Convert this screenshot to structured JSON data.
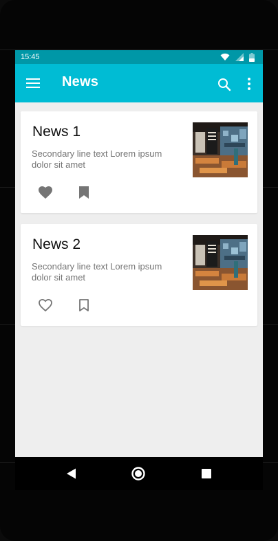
{
  "status_bar": {
    "time": "15:45",
    "icons": [
      "wifi-icon",
      "signal-icon",
      "battery-icon"
    ]
  },
  "app_bar": {
    "title": "News",
    "icons": [
      "menu-icon",
      "search-icon",
      "more-vert-icon"
    ]
  },
  "news": [
    {
      "title": "News 1",
      "subtitle": "Secondary line text Lorem ipsum dolor sit amet",
      "thumbnail": "cafe-photo",
      "favorite": true,
      "bookmarked": true
    },
    {
      "title": "News 2",
      "subtitle": "Secondary line text Lorem ipsum dolor sit amet",
      "thumbnail": "cafe-photo",
      "favorite": false,
      "bookmarked": false
    }
  ],
  "nav_bar": {
    "icons": [
      "back-icon",
      "home-icon",
      "recents-icon"
    ]
  },
  "colors": {
    "primary": "#00BCD4",
    "primary_dark": "#0097A7",
    "background": "#EEEEEE",
    "card": "#FFFFFF",
    "icon_gray": "#757575"
  }
}
